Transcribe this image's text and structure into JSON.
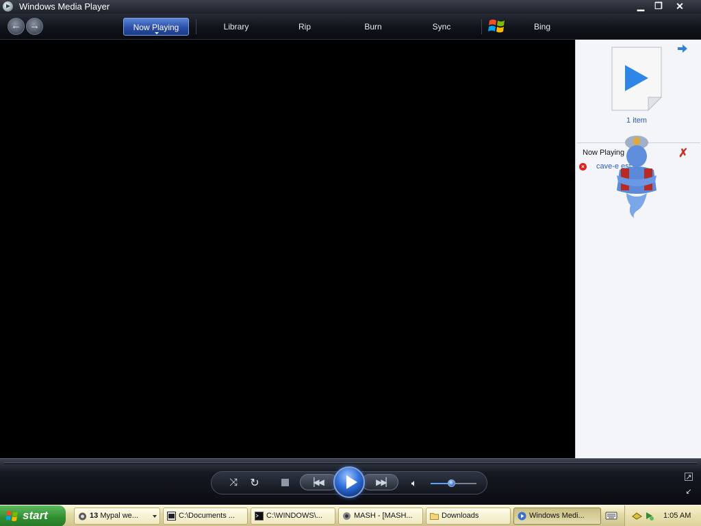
{
  "window": {
    "title": "Windows Media Player"
  },
  "nav": {
    "tabs": [
      {
        "label": "Now Playing"
      },
      {
        "label": "Library"
      },
      {
        "label": "Rip"
      },
      {
        "label": "Burn"
      },
      {
        "label": "Sync"
      },
      {
        "label": "Bing"
      }
    ]
  },
  "pane": {
    "item_count": "1 item",
    "now_playing_label": "Now Playing",
    "track": "cave-e      est"
  },
  "controls": {
    "volume_fraction": 0.47
  },
  "taskbar": {
    "start_label": "start",
    "tasks": [
      {
        "count": "13",
        "label": "Mypal we..."
      },
      {
        "label": "C:\\Documents ..."
      },
      {
        "label": "C:\\WINDOWS\\..."
      },
      {
        "label": "MASH - [MASH..."
      },
      {
        "label": "Downloads"
      },
      {
        "label": "Windows Medi..."
      }
    ],
    "clock": "1:05 AM"
  },
  "colors": {
    "accent": "#2b4fa8",
    "link": "#2a5bb5",
    "clear": "#c93023"
  }
}
